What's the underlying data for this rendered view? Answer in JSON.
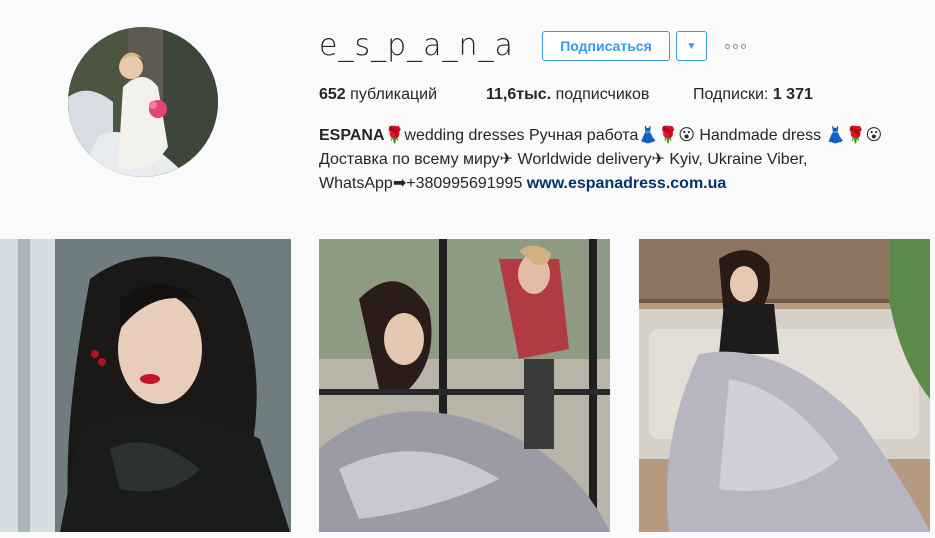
{
  "profile": {
    "username": "e_s_p_a_n_a",
    "follow_label": "Подписаться",
    "dropdown_glyph": "▼",
    "posts_count": "652",
    "posts_label": "публикаций",
    "followers_count": "11,6тыс.",
    "followers_label": "подписчиков",
    "following_label": "Подписки:",
    "following_count": "1 371",
    "bio": {
      "name": "ESPANA",
      "line1_rest": "🌹wedding dresses Ручная работа👗🌹😮 Handmade dress 👗🌹😮",
      "line2": "Доставка по всему миру✈ Worldwide delivery✈ Kyiv, Ukraine Viber,",
      "line3": "WhatsApp➡+380995691995",
      "link": "www.espanadress.com.ua"
    }
  },
  "posts": [
    {
      "kind": "photo",
      "subject": "woman-black-lace-red-lips"
    },
    {
      "kind": "photo",
      "subject": "photographer-and-bride-reflection"
    },
    {
      "kind": "photo",
      "subject": "bride-grey-gown-sofa"
    }
  ],
  "colors": {
    "accent": "#3897f0",
    "link": "#003569",
    "text": "#262626",
    "background": "#fafafa"
  }
}
